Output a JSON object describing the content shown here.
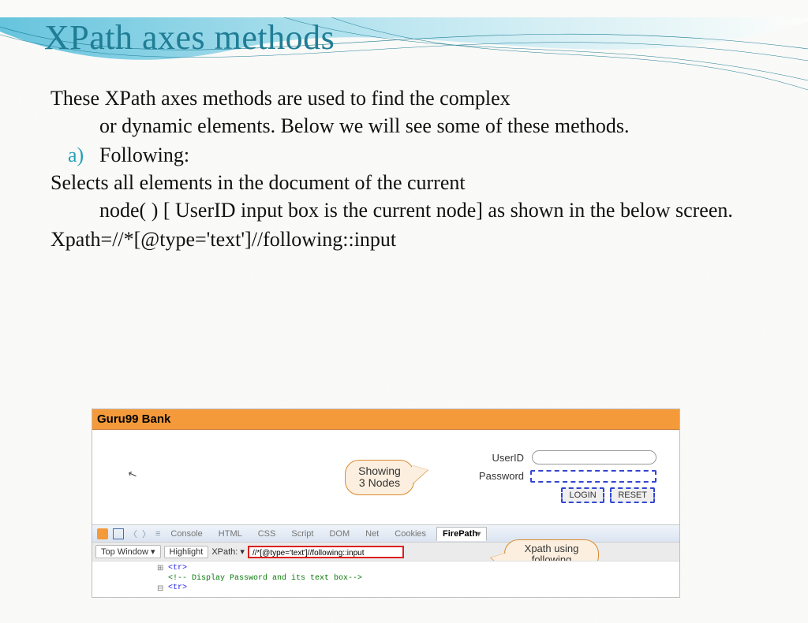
{
  "title": "XPath axes methods",
  "intro_first": "These XPath axes methods are used to find the complex",
  "intro_rest": "or dynamic elements. Below we will see some of these methods.",
  "list": {
    "marker": "a)",
    "item": "Following:"
  },
  "following_first": "Selects all elements in the document of the current",
  "following_rest": "node( ) [ UserID input box is the current node] as shown in the below screen.",
  "xpath_line": "Xpath=//*[@type='text']//following::input",
  "embed": {
    "brand": "Guru99 Bank",
    "callout1_l1": "Showing",
    "callout1_l2": "3 Nodes",
    "labels": {
      "userid": "UserID",
      "password": "Password"
    },
    "buttons": {
      "login": "LOGIN",
      "reset": "RESET"
    },
    "dev_tabs": {
      "console": "Console",
      "html": "HTML",
      "css": "CSS",
      "script": "Script",
      "dom": "DOM",
      "net": "Net",
      "cookies": "Cookies",
      "firepath": "FirePath"
    },
    "row2": {
      "topwindow": "Top Window",
      "highlight": "Highlight",
      "xpath_label": "XPath:",
      "xpath_value": "//*[@type='text']//following::input"
    },
    "callout2_l1": "Xpath using",
    "callout2_l2": "following",
    "code": {
      "l1_exp": "⊞",
      "l1": "<tr>",
      "l2": "<!-- Display Password and its text box-->",
      "l3_exp": "⊟",
      "l3": "<tr>"
    }
  }
}
